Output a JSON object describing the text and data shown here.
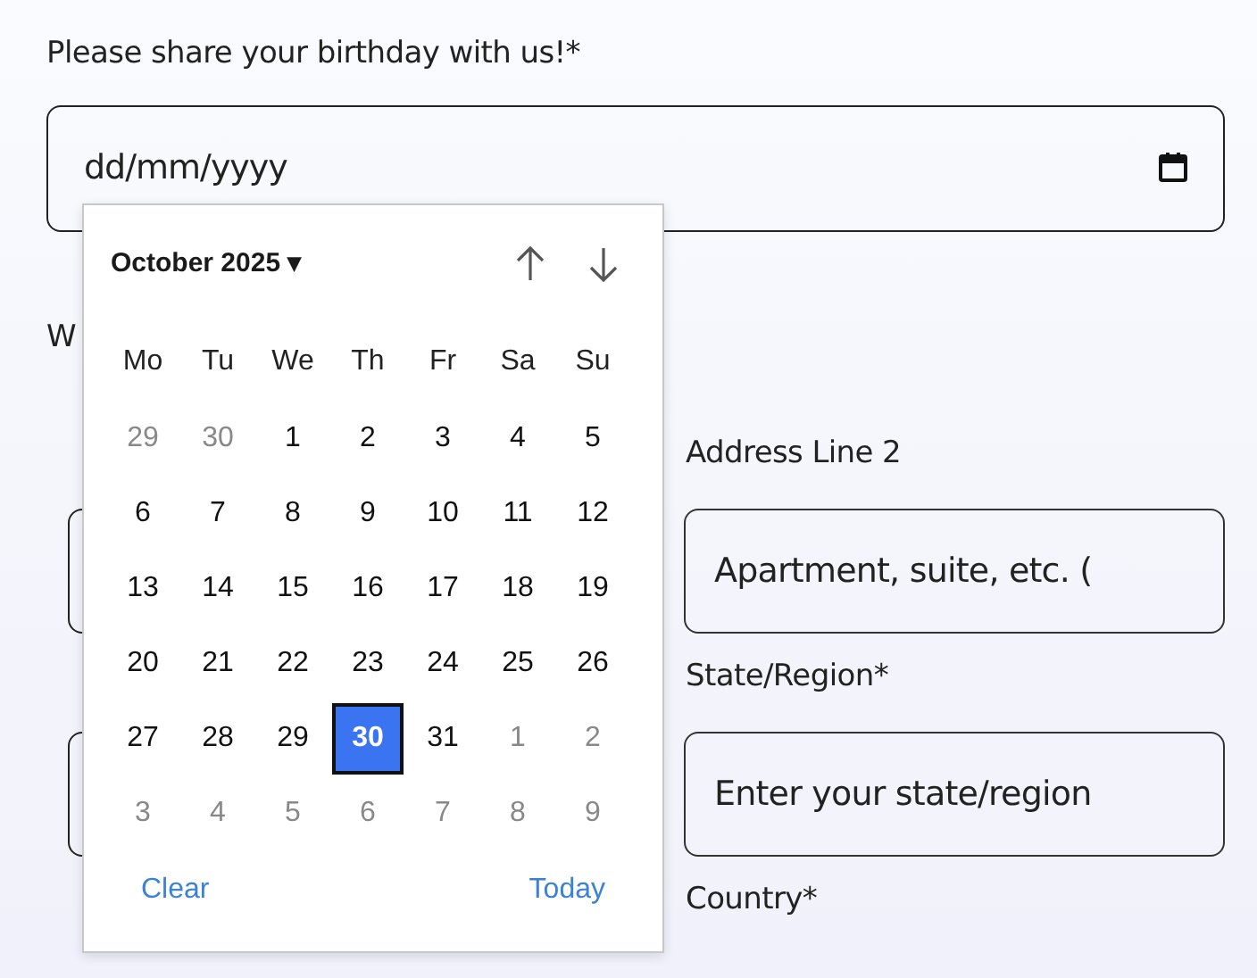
{
  "birthday": {
    "label": "Please share your birthday with us!*",
    "placeholder": "dd/mm/yyyy"
  },
  "section_title": "W",
  "fields": [
    {
      "label": "Address Line 2",
      "placeholder": "Apartment, suite, etc. ("
    },
    {
      "label": "State/Region*",
      "placeholder": "Enter your state/region"
    },
    {
      "label": "Country*"
    }
  ],
  "calendar": {
    "month_label": "October 2025",
    "caret": "▾",
    "weekdays": [
      "Mo",
      "Tu",
      "We",
      "Th",
      "Fr",
      "Sa",
      "Su"
    ],
    "weeks": [
      [
        {
          "day": "29",
          "outside_month": true,
          "selected": false
        },
        {
          "day": "30",
          "outside_month": true,
          "selected": false
        },
        {
          "day": "1",
          "outside_month": false,
          "selected": false
        },
        {
          "day": "2",
          "outside_month": false,
          "selected": false
        },
        {
          "day": "3",
          "outside_month": false,
          "selected": false
        },
        {
          "day": "4",
          "outside_month": false,
          "selected": false
        },
        {
          "day": "5",
          "outside_month": false,
          "selected": false
        }
      ],
      [
        {
          "day": "6",
          "outside_month": false,
          "selected": false
        },
        {
          "day": "7",
          "outside_month": false,
          "selected": false
        },
        {
          "day": "8",
          "outside_month": false,
          "selected": false
        },
        {
          "day": "9",
          "outside_month": false,
          "selected": false
        },
        {
          "day": "10",
          "outside_month": false,
          "selected": false
        },
        {
          "day": "11",
          "outside_month": false,
          "selected": false
        },
        {
          "day": "12",
          "outside_month": false,
          "selected": false
        }
      ],
      [
        {
          "day": "13",
          "outside_month": false,
          "selected": false
        },
        {
          "day": "14",
          "outside_month": false,
          "selected": false
        },
        {
          "day": "15",
          "outside_month": false,
          "selected": false
        },
        {
          "day": "16",
          "outside_month": false,
          "selected": false
        },
        {
          "day": "17",
          "outside_month": false,
          "selected": false
        },
        {
          "day": "18",
          "outside_month": false,
          "selected": false
        },
        {
          "day": "19",
          "outside_month": false,
          "selected": false
        }
      ],
      [
        {
          "day": "20",
          "outside_month": false,
          "selected": false
        },
        {
          "day": "21",
          "outside_month": false,
          "selected": false
        },
        {
          "day": "22",
          "outside_month": false,
          "selected": false
        },
        {
          "day": "23",
          "outside_month": false,
          "selected": false
        },
        {
          "day": "24",
          "outside_month": false,
          "selected": false
        },
        {
          "day": "25",
          "outside_month": false,
          "selected": false
        },
        {
          "day": "26",
          "outside_month": false,
          "selected": false
        }
      ],
      [
        {
          "day": "27",
          "outside_month": false,
          "selected": false
        },
        {
          "day": "28",
          "outside_month": false,
          "selected": false
        },
        {
          "day": "29",
          "outside_month": false,
          "selected": false
        },
        {
          "day": "30",
          "outside_month": false,
          "selected": true
        },
        {
          "day": "31",
          "outside_month": false,
          "selected": false
        },
        {
          "day": "1",
          "outside_month": true,
          "selected": false
        },
        {
          "day": "2",
          "outside_month": true,
          "selected": false
        }
      ],
      [
        {
          "day": "3",
          "outside_month": true,
          "selected": false
        },
        {
          "day": "4",
          "outside_month": true,
          "selected": false
        },
        {
          "day": "5",
          "outside_month": true,
          "selected": false
        },
        {
          "day": "6",
          "outside_month": true,
          "selected": false
        },
        {
          "day": "7",
          "outside_month": true,
          "selected": false
        },
        {
          "day": "8",
          "outside_month": true,
          "selected": false
        },
        {
          "day": "9",
          "outside_month": true,
          "selected": false
        }
      ]
    ],
    "buttons": [
      "Clear",
      "Today"
    ]
  }
}
